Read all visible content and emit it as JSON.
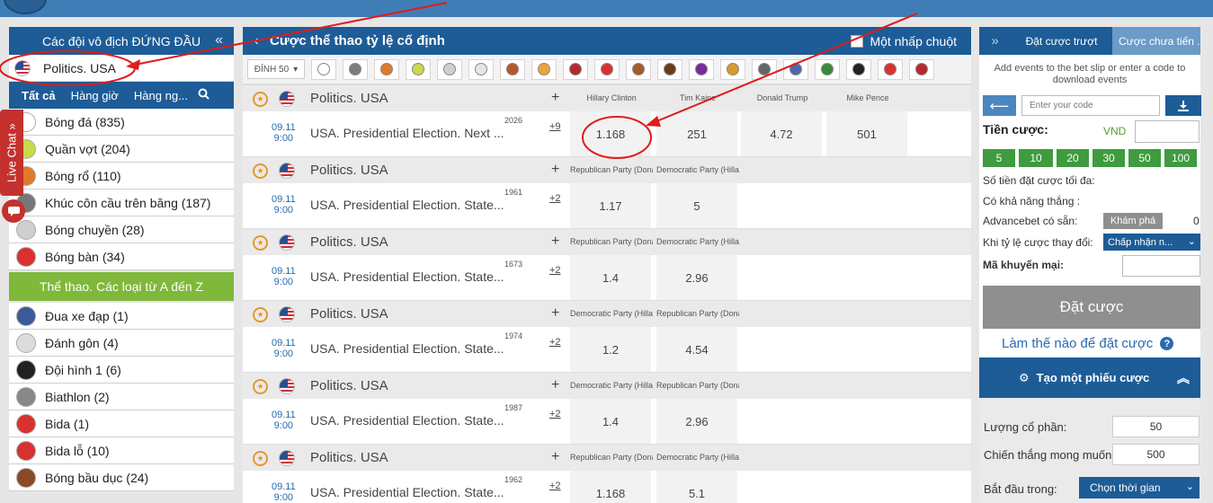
{
  "left": {
    "top_teams_title": "Các đội vô địch ĐỨNG ĐẦU",
    "favorite": "Politics. USA",
    "tabs": [
      "Tất cả",
      "Hàng giờ",
      "Hàng ng..."
    ],
    "sports": [
      {
        "name": "Bóng đá (835)",
        "icon": "soccer-ball-icon",
        "color": "#ffffff"
      },
      {
        "name": "Quần vợt (204)",
        "icon": "tennis-ball-icon",
        "color": "#c9d94a"
      },
      {
        "name": "Bóng rổ (110)",
        "icon": "basketball-icon",
        "color": "#e07a2a"
      },
      {
        "name": "Khúc côn cầu trên băng (187)",
        "icon": "hockey-icon",
        "color": "#777777"
      },
      {
        "name": "Bóng chuyền (28)",
        "icon": "volleyball-icon",
        "color": "#cfcfcf"
      },
      {
        "name": "Bóng bàn (34)",
        "icon": "table-tennis-icon",
        "color": "#d8322f"
      }
    ],
    "az_title": "Thể thao. Các loại từ A đến Z",
    "az_sports": [
      {
        "name": "Đua xe đạp (1)",
        "icon": "cycling-icon",
        "color": "#3a5a9a"
      },
      {
        "name": "Đánh gôn (4)",
        "icon": "golf-ball-icon",
        "color": "#dcdcdc"
      },
      {
        "name": "Đội hình 1 (6)",
        "icon": "formula1-wheel-icon",
        "color": "#222222"
      },
      {
        "name": "Biathlon (2)",
        "icon": "biathlon-icon",
        "color": "#888888"
      },
      {
        "name": "Bida (1)",
        "icon": "billiards-icon",
        "color": "#d8322f"
      },
      {
        "name": "Bida lỗ (10)",
        "icon": "snooker-icon",
        "color": "#d8322f"
      },
      {
        "name": "Bóng bầu dục (24)",
        "icon": "rugby-ball-icon",
        "color": "#8a4a26"
      }
    ],
    "live_chat": "Live Chat »"
  },
  "main": {
    "title": "Cược thể thao tỷ lệ cố định",
    "one_click": "Một nhấp chuột",
    "top_filter": "ĐỈNH 50",
    "sport_icon_colors": [
      "#ffffff",
      "#7d7d7d",
      "#e07a2a",
      "#c9d94a",
      "#cfcfcf",
      "#e6e6e6",
      "#b8562a",
      "#f0a23a",
      "#b8262e",
      "#d8322f",
      "#a55a2a",
      "#6b3a1a",
      "#7a2a9a",
      "#d89a2a",
      "#666666",
      "#4a6aaa",
      "#3a8a3a",
      "#222222",
      "#d8322f",
      "#b8262e"
    ],
    "events": [
      {
        "league": "Politics. USA",
        "cols": [
          "Hillary Clinton",
          "Tim Kaine",
          "Donald Trump",
          "Mike Pence"
        ],
        "date": "09.11",
        "time": "9:00",
        "name": "USA. Presidential Election. Next ...",
        "id": "2026",
        "more": "+9",
        "odds": [
          "1.168",
          "251",
          "4.72",
          "501"
        ]
      },
      {
        "league": "Politics. USA",
        "cols": [
          "Republican Party (Donald Trump)",
          "Democratic Party (Hillary Clinton)"
        ],
        "date": "09.11",
        "time": "9:00",
        "name": "USA. Presidential Election. State...",
        "id": "1961",
        "more": "+2",
        "odds": [
          "1.17",
          "5"
        ]
      },
      {
        "league": "Politics. USA",
        "cols": [
          "Republican Party (Donald Trump)",
          "Democratic Party (Hillary Clinton)"
        ],
        "date": "09.11",
        "time": "9:00",
        "name": "USA. Presidential Election. State...",
        "id": "1673",
        "more": "+2",
        "odds": [
          "1.4",
          "2.96"
        ]
      },
      {
        "league": "Politics. USA",
        "cols": [
          "Democratic Party (Hillary Clinton)",
          "Republican Party (Donald Trump)"
        ],
        "date": "09.11",
        "time": "9:00",
        "name": "USA. Presidential Election. State...",
        "id": "1974",
        "more": "+2",
        "odds": [
          "1.2",
          "4.54"
        ]
      },
      {
        "league": "Politics. USA",
        "cols": [
          "Democratic Party (Hillary Clinton)",
          "Republican Party (Donald Trump)"
        ],
        "date": "09.11",
        "time": "9:00",
        "name": "USA. Presidential Election. State...",
        "id": "1987",
        "more": "+2",
        "odds": [
          "1.4",
          "2.96"
        ]
      },
      {
        "league": "Politics. USA",
        "cols": [
          "Republican Party (Donald Trump)",
          "Democratic Party (Hillary Clinton)"
        ],
        "date": "09.11",
        "time": "9:00",
        "name": "USA. Presidential Election. State...",
        "id": "1962",
        "more": "+2",
        "odds": [
          "1.168",
          "5.1"
        ]
      }
    ]
  },
  "right": {
    "tab_place": "Đặt cược trượt",
    "tab_pending": "Cược chưa tiến ...",
    "hint": "Add events to the bet slip or enter a code to download events",
    "code_placeholder": "Enter your code",
    "stake_label": "Tiền cược:",
    "currency": "VND",
    "chips": [
      "5",
      "10",
      "20",
      "30",
      "50",
      "100"
    ],
    "max_stake": "Số tiền đặt cược tối đa:",
    "possible_win": "Có khả năng thắng :",
    "advancebet": "Advancebet có sẵn:",
    "explore": "Khám phá",
    "advancebet_value": "0",
    "odds_change": "Khi tỷ lệ cược thay đổi:",
    "odds_change_value": "Chấp nhận n...",
    "promo": "Mã khuyến mại:",
    "place_bet": "Đặt cược",
    "how_to": "Làm thế nào để đặt cược",
    "make_slip": "Tạo một phiếu cược",
    "share_label": "Lượng cổ phần:",
    "share_value": "50",
    "desired_win_label": "Chiến thắng mong muốn:",
    "desired_win_value": "500",
    "start_label": "Bắt đầu trong:",
    "start_value": "Chọn thời gian"
  }
}
